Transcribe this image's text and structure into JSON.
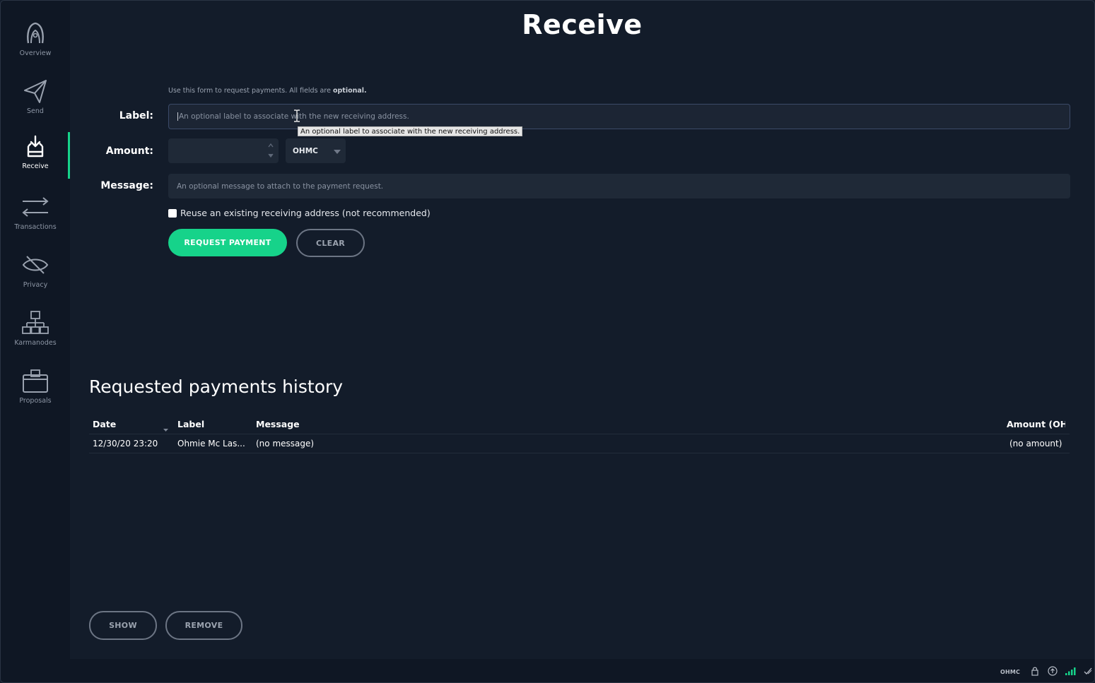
{
  "sidebar": {
    "items": [
      {
        "label": "Overview",
        "icon": "overview-logo-icon",
        "active": false
      },
      {
        "label": "Send",
        "icon": "paper-plane-icon",
        "active": false
      },
      {
        "label": "Receive",
        "icon": "inbox-download-icon",
        "active": true
      },
      {
        "label": "Transactions",
        "icon": "swap-arrows-icon",
        "active": false
      },
      {
        "label": "Privacy",
        "icon": "eye-slash-icon",
        "active": false
      },
      {
        "label": "Karmanodes",
        "icon": "network-nodes-icon",
        "active": false
      },
      {
        "label": "Proposals",
        "icon": "ballot-box-icon",
        "active": false
      }
    ]
  },
  "page": {
    "title": "Receive",
    "intro_text": "Use this form to request payments. All fields are",
    "intro_bold": "optional."
  },
  "form": {
    "label_caption": "Label:",
    "label_placeholder": "An optional label to associate with the new receiving address.",
    "label_tooltip": "An optional label to associate with the new receiving address.",
    "amount_caption": "Amount:",
    "amount_value": "",
    "unit_selected": "OHMC",
    "message_caption": "Message:",
    "message_placeholder": "An optional message to attach to the payment request.",
    "reuse_checkbox_label": "Reuse an existing receiving address (not recommended)",
    "reuse_checked": false,
    "request_button": "REQUEST PAYMENT",
    "clear_button": "CLEAR"
  },
  "history": {
    "title": "Requested payments history",
    "columns": [
      "Date",
      "Label",
      "Message",
      "Amount (OHI"
    ],
    "rows": [
      {
        "date": "12/30/20 23:20",
        "label": "Ohmie Mc Las...",
        "message": "(no message)",
        "amount": "(no amount)"
      }
    ],
    "show_button": "SHOW",
    "remove_button": "REMOVE"
  },
  "statusbar": {
    "unit": "OHMC"
  },
  "colors": {
    "accent": "#16d38a",
    "background": "#131c2a",
    "sidebar": "#0f1724",
    "field": "#1f2937"
  }
}
